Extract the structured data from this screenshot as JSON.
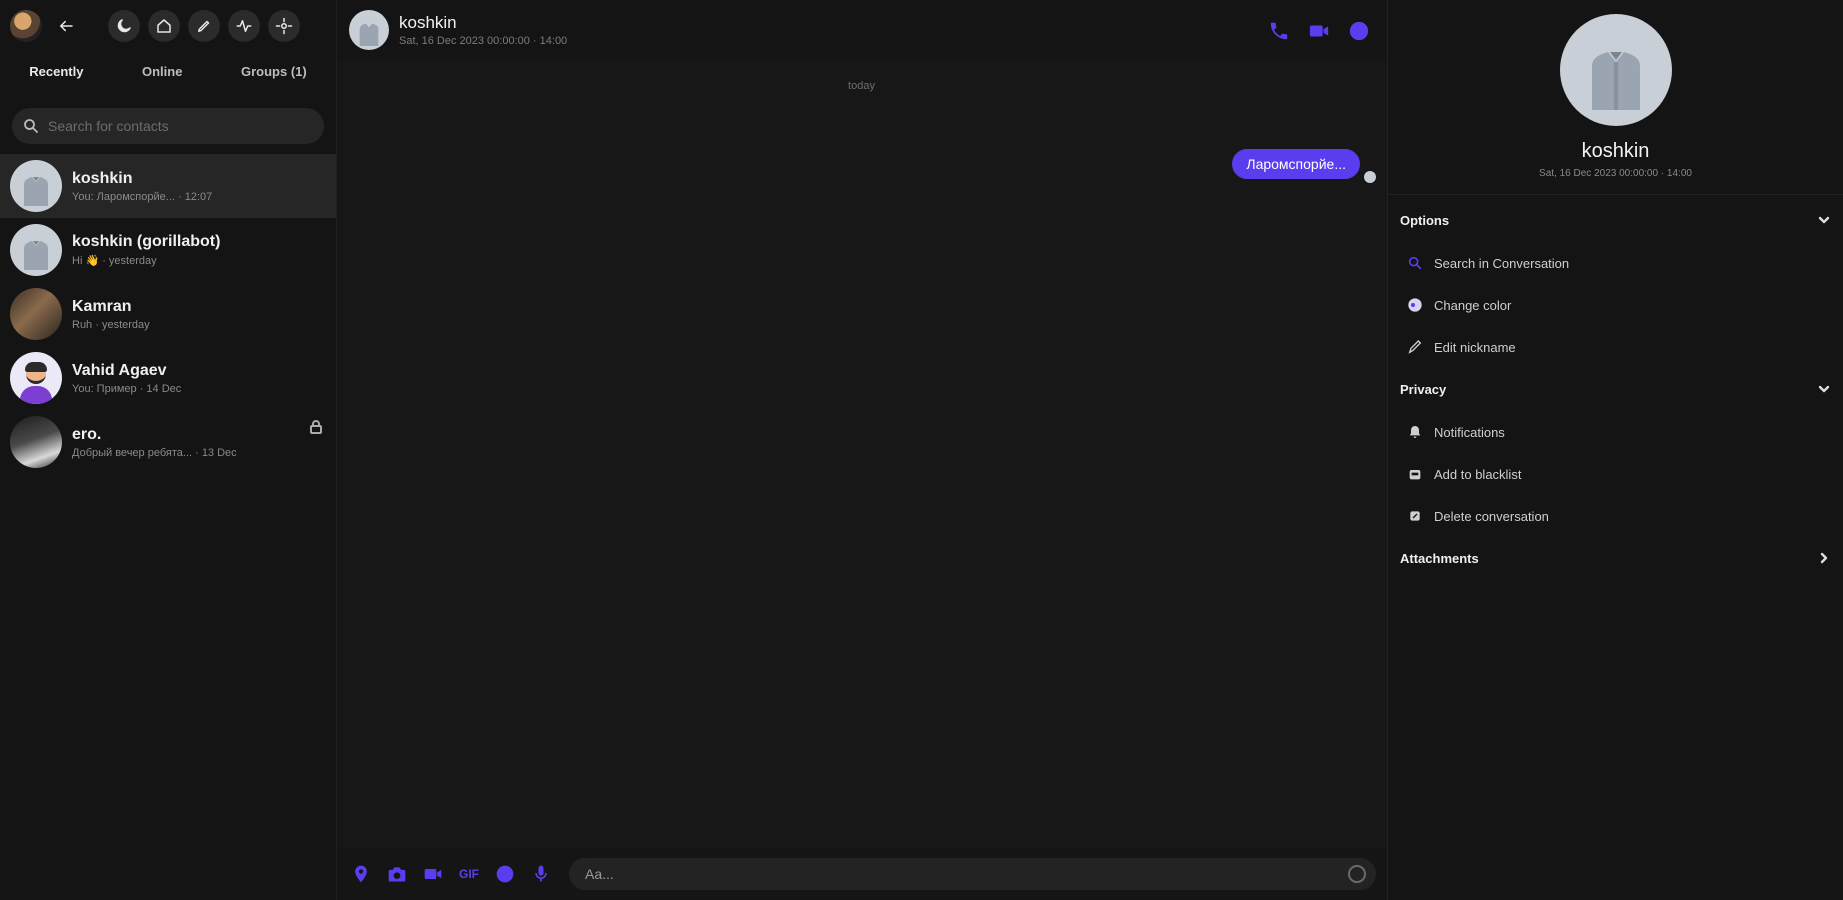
{
  "toolbar": {
    "icons": [
      "profile-avatar",
      "back-arrow-icon",
      "moon-icon",
      "home-icon",
      "edit-icon",
      "pulse-icon",
      "settings-icon"
    ]
  },
  "tabs": [
    {
      "label": "Recently",
      "active": true
    },
    {
      "label": "Online",
      "active": false
    },
    {
      "label": "Groups (1)",
      "active": false
    }
  ],
  "search": {
    "placeholder": "Search for contacts"
  },
  "contacts": [
    {
      "name": "koshkin",
      "preview": "You: Ларомспорйе... · 12:07"
    },
    {
      "name": "koshkin (gorillabot)",
      "preview": "Hi 👋 · yesterday"
    },
    {
      "name": "Kamran",
      "preview": "Ruh · yesterday"
    },
    {
      "name": "Vahid Agaev",
      "preview": "You: Пример · 14 Dec"
    },
    {
      "name": "ero.",
      "preview": "Добрый вечер ребята... · 13 Dec"
    }
  ],
  "chat": {
    "name": "koshkin",
    "status": "Sat, 16 Dec 2023 00:00:00 · 14:00",
    "date_separator": "today",
    "messages": [
      {
        "text": "Ларомспорйе...",
        "outgoing": true
      }
    ],
    "composer_placeholder": "Aa..."
  },
  "profile": {
    "name": "koshkin",
    "status": "Sat, 16 Dec 2023 00:00:00 · 14:00",
    "sections": {
      "options": "Options",
      "privacy": "Privacy",
      "attachments": "Attachments"
    },
    "options": [
      {
        "label": "Search in Conversation"
      },
      {
        "label": "Change color"
      },
      {
        "label": "Edit nickname"
      }
    ],
    "privacy": [
      {
        "label": "Notifications"
      },
      {
        "label": "Add to blacklist"
      },
      {
        "label": "Delete conversation"
      }
    ]
  },
  "colors": {
    "accent": "#5b3df0",
    "background": "#161616",
    "panel": "#141414"
  }
}
